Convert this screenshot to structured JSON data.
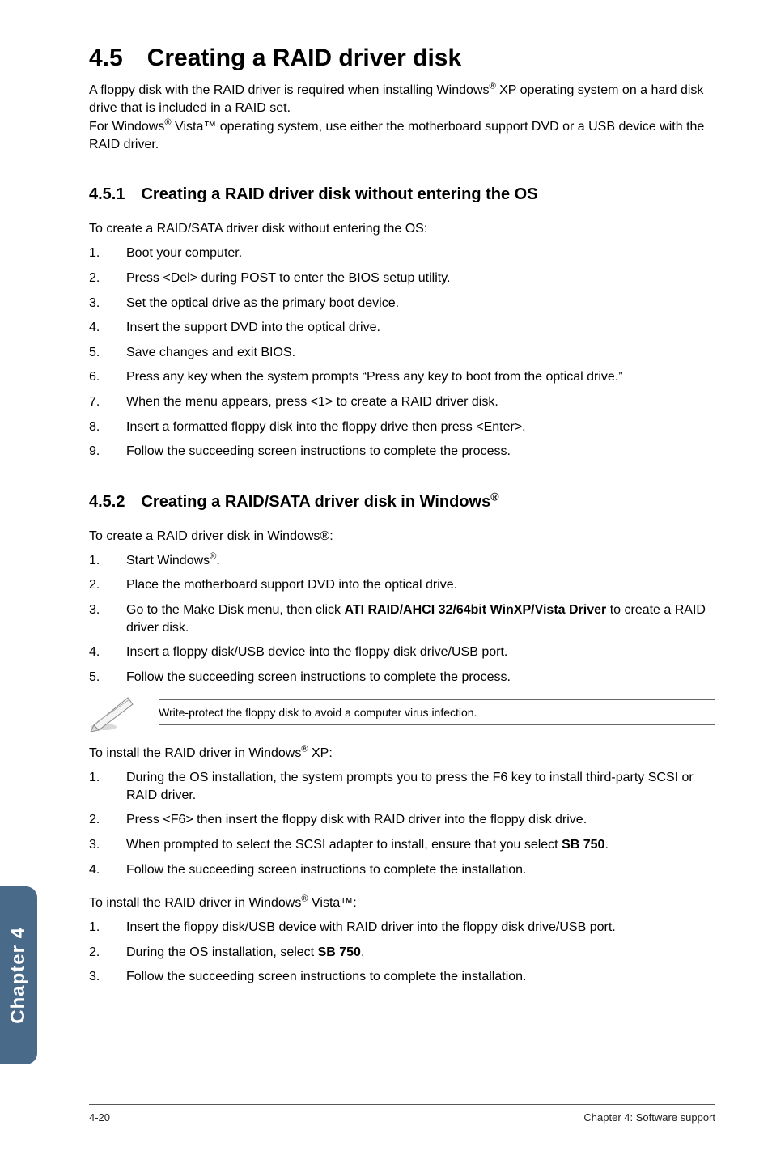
{
  "title": "4.5 Creating a RAID driver disk",
  "intro_lines": [
    "A floppy disk with the RAID driver is required when installing Windows",
    " XP operating system on a hard disk drive that is included in a RAID set.",
    "For Windows",
    " Vista™ operating system, use either the motherboard support DVD or a USB device with the RAID driver."
  ],
  "s451": {
    "heading": "4.5.1 Creating a RAID driver disk without entering the OS",
    "lead": "To create a RAID/SATA driver disk without entering the OS:",
    "items": [
      "Boot your computer.",
      "Press <Del> during POST to enter the BIOS setup utility.",
      "Set the optical drive as the primary boot device.",
      "Insert the support DVD into the optical drive.",
      "Save changes and exit BIOS.",
      "Press any key when the system prompts “Press any key to boot from the optical drive.”",
      "When the menu appears, press <1> to create a RAID driver disk.",
      "Insert a formatted floppy disk into the floppy drive then press <Enter>.",
      "Follow the succeeding screen instructions to complete the process."
    ]
  },
  "s452": {
    "heading_pre": "4.5.2 Creating a RAID/SATA driver disk in Windows",
    "heading_sup": "®",
    "lead": "To create a RAID driver disk in Windows®:",
    "items_pre": [
      "Start Windows",
      "Place the motherboard support DVD into the optical drive."
    ],
    "items_pre_sup": "®",
    "item3_pre": "Go to the Make Disk menu, then click ",
    "item3_bold": "ATI RAID/AHCI 32/64bit WinXP/Vista Driver",
    "item3_post": " to create a RAID driver disk.",
    "items_post": [
      "Insert a floppy disk/USB device into the floppy disk drive/USB port.",
      "Follow the succeeding screen instructions to complete the process."
    ],
    "note": "Write-protect the floppy disk to avoid a computer virus infection.",
    "xp_lead_pre": "To install the RAID driver in Windows",
    "xp_lead_post": " XP:",
    "xp_items": [
      "During the OS installation, the system prompts you to press the F6 key to install third-party SCSI or RAID driver.",
      "Press <F6> then insert the floppy disk with RAID driver into the floppy disk drive."
    ],
    "xp_item3_pre": "When prompted to select the SCSI adapter to install, ensure that you select ",
    "xp_item3_bold": "SB 750",
    "xp_item3_post": ".",
    "xp_item4": "Follow the succeeding screen instructions to complete the installation.",
    "vista_lead_pre": "To install the RAID driver in Windows",
    "vista_lead_post": " Vista™:",
    "vista_item1": "Insert the floppy disk/USB device with RAID driver into the floppy disk drive/USB port.",
    "vista_item2_pre": "During the OS installation, select ",
    "vista_item2_bold": "SB 750",
    "vista_item2_post": ".",
    "vista_item3": "Follow the succeeding screen instructions to complete the installation."
  },
  "side_tab": "Chapter 4",
  "footer_left": "4-20",
  "footer_right": "Chapter 4: Software support",
  "sup_r": "®"
}
